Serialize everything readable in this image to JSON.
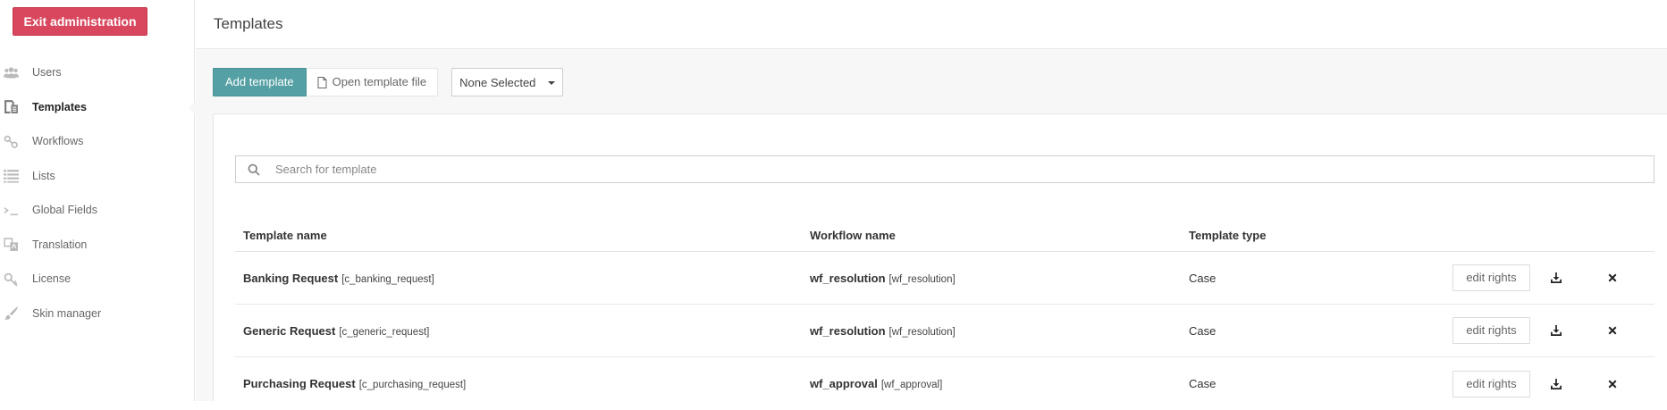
{
  "sidebar": {
    "exit_label": "Exit administration",
    "items": [
      {
        "label": "Users",
        "icon": "users-icon"
      },
      {
        "label": "Templates",
        "icon": "templates-icon",
        "active": true
      },
      {
        "label": "Workflows",
        "icon": "workflows-icon"
      },
      {
        "label": "Lists",
        "icon": "list-icon"
      },
      {
        "label": "Global Fields",
        "icon": "terminal-icon"
      },
      {
        "label": "Translation",
        "icon": "translation-icon"
      },
      {
        "label": "License",
        "icon": "key-icon"
      },
      {
        "label": "Skin manager",
        "icon": "brush-icon"
      }
    ]
  },
  "header": {
    "title": "Templates"
  },
  "toolbar": {
    "add_label": "Add template",
    "open_label": "Open template file",
    "select_value": "None Selected"
  },
  "search": {
    "placeholder": "Search for template",
    "value": ""
  },
  "table": {
    "headers": [
      "Template name",
      "Workflow name",
      "Template type"
    ],
    "rows": [
      {
        "name": "Banking Request",
        "code": "[c_banking_request]",
        "workflow": "wf_resolution",
        "workflow_code": "[wf_resolution]",
        "type": "Case",
        "action": "edit rights"
      },
      {
        "name": "Generic Request",
        "code": "[c_generic_request]",
        "workflow": "wf_resolution",
        "workflow_code": "[wf_resolution]",
        "type": "Case",
        "action": "edit rights"
      },
      {
        "name": "Purchasing Request",
        "code": "[c_purchasing_request]",
        "workflow": "wf_approval",
        "workflow_code": "[wf_approval]",
        "type": "Case",
        "action": "edit rights"
      }
    ]
  },
  "colors": {
    "accent": "#55a0a4",
    "exit": "#d9475e"
  }
}
